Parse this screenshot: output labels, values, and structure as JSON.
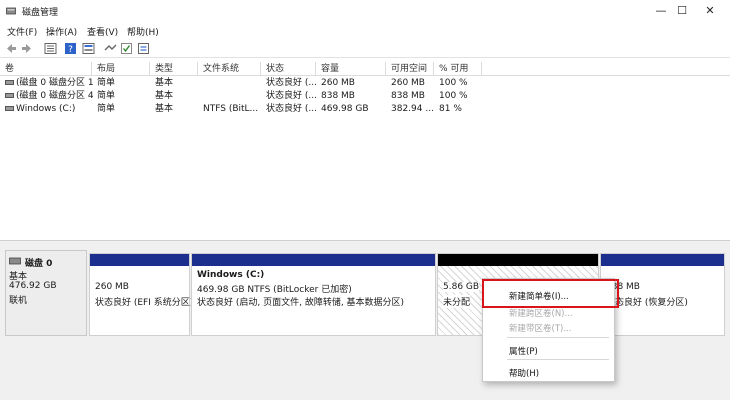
{
  "window": {
    "title": "磁盘管理",
    "minimize": "—",
    "maximize": "☐",
    "close": "✕"
  },
  "menu": [
    "文件(F)",
    "操作(A)",
    "查看(V)",
    "帮助(H)"
  ],
  "toolbar_icons": [
    "back-icon",
    "forward-icon",
    "properties-icon",
    "help-icon",
    "disk-list-icon",
    "check-icon",
    "settings-icon"
  ],
  "table": {
    "headers": [
      "卷",
      "布局",
      "类型",
      "文件系统",
      "状态",
      "容量",
      "可用空间",
      "% 可用"
    ],
    "rows": [
      [
        "(磁盘 0 磁盘分区 1)",
        "简单",
        "基本",
        "",
        "状态良好 (...",
        "260 MB",
        "260 MB",
        "100 %"
      ],
      [
        "(磁盘 0 磁盘分区 4)",
        "简单",
        "基本",
        "",
        "状态良好 (...",
        "838 MB",
        "838 MB",
        "100 %"
      ],
      [
        "Windows (C:)",
        "简单",
        "基本",
        "NTFS (BitL...",
        "状态良好 (...",
        "469.98 GB",
        "382.94 ...",
        "81 %"
      ]
    ]
  },
  "disk": {
    "name": "磁盘 0",
    "type": "基本",
    "size": "476.92 GB",
    "status": "联机"
  },
  "partitions": [
    {
      "line1": "260 MB",
      "line2": "状态良好 (EFI 系统分区)"
    },
    {
      "title": "Windows (C:)",
      "line1": "469.98 GB NTFS (BitLocker 已加密)",
      "line2": "状态良好 (启动, 页面文件, 故障转储, 基本数据分区)"
    },
    {
      "line1": "5.86 GB",
      "line2": "未分配"
    },
    {
      "line1": "838 MB",
      "line2": "状态良好 (恢复分区)"
    }
  ],
  "context_menu": {
    "items": [
      {
        "label": "新建简单卷(I)...",
        "disabled": false
      },
      {
        "label": "新建跨区卷(N)...",
        "disabled": true
      },
      {
        "label": "新建带区卷(T)...",
        "disabled": true
      },
      {
        "label": "属性(P)",
        "disabled": false
      },
      {
        "label": "帮助(H)",
        "disabled": false
      }
    ]
  },
  "colors": {
    "partition_bar": "#1c2f8f",
    "unallocated_bar": "#000000",
    "highlight": "#d9141b"
  }
}
